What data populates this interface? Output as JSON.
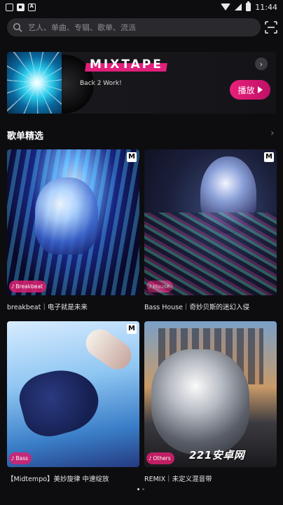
{
  "status_bar": {
    "time": "11:44"
  },
  "search": {
    "placeholder": "艺人、单曲、专辑、歌单、流派"
  },
  "banner": {
    "title": "MIXTAPE",
    "subtitle": "Back 2 Work!",
    "play_label": "播放",
    "more_glyph": "›"
  },
  "section": {
    "title": "歌单精选",
    "arrow": "›"
  },
  "playlists": [
    {
      "label": "breakbeat｜电子就是未来",
      "badge": "Breakbeat"
    },
    {
      "label": "Bass House｜奇妙贝斯的迷幻入侵",
      "badge": "House"
    },
    {
      "label": "【Midtempo】美妙旋律 中速绽放",
      "badge": "Bass"
    },
    {
      "label": "REMIX｜未定义混音带",
      "badge": "Others"
    }
  ],
  "watermark": "221安卓网",
  "colors": {
    "accent": "#e0207a",
    "background": "#0d0d10"
  }
}
